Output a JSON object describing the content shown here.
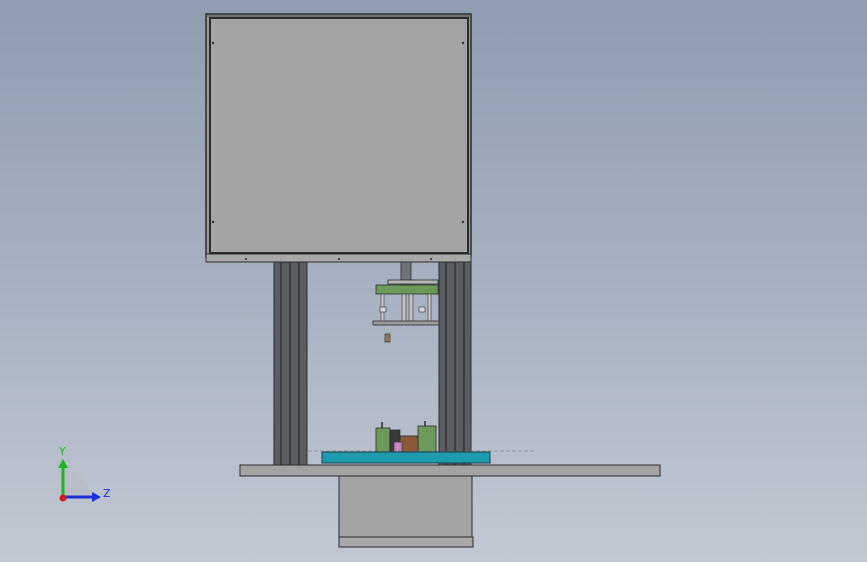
{
  "viewport": {
    "background_top": "#8f9db1",
    "background_bottom": "#c2c8d3"
  },
  "triad": {
    "y_label": "Y",
    "z_label": "Z",
    "y_color": "#1fb51f",
    "z_color": "#1a2fd6",
    "x_color": "#d11a1a"
  },
  "colors": {
    "panel": "#a4a4a4",
    "panel_edge": "#2b2b2b",
    "column": "#5a5d62",
    "column_dark": "#3e4045",
    "table": "#a3a3a3",
    "base_plate": "#1f9bb0",
    "green_part": "#6d9a5a",
    "brown_part": "#8a5a3a",
    "pink_part": "#c487c0",
    "cylinder": "#808388"
  }
}
